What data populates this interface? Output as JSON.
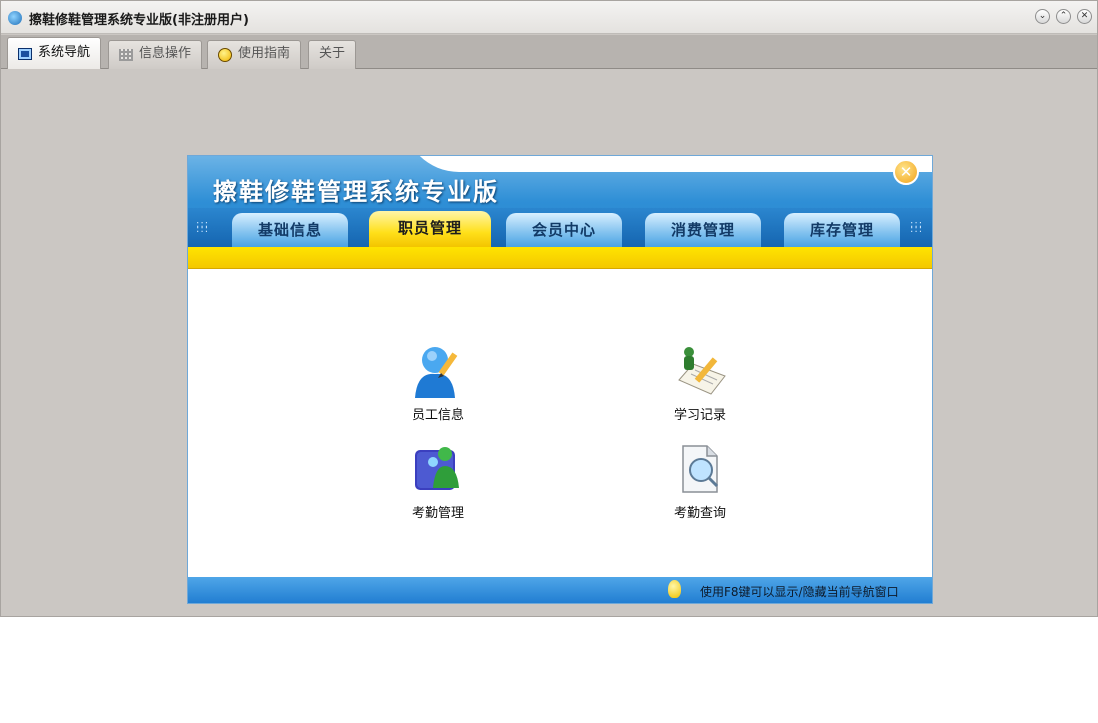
{
  "window": {
    "title": "擦鞋修鞋管理系统专业版(非注册用户)",
    "controls": [
      "⌄",
      "⌃",
      "✕"
    ]
  },
  "tabs": [
    {
      "label": "系统导航",
      "icon": "monitor-icon",
      "active": true
    },
    {
      "label": "信息操作",
      "icon": "grid-icon",
      "active": false
    },
    {
      "label": "使用指南",
      "icon": "smiley-icon",
      "active": false
    },
    {
      "label": "关于",
      "icon": "",
      "active": false
    }
  ],
  "panel": {
    "title": "擦鞋修鞋管理系统专业版",
    "close_glyph": "✕",
    "nav_tabs": [
      {
        "label": "基础信息",
        "active": false
      },
      {
        "label": "职员管理",
        "active": true
      },
      {
        "label": "会员中心",
        "active": false
      },
      {
        "label": "消费管理",
        "active": false
      },
      {
        "label": "库存管理",
        "active": false
      }
    ],
    "items": [
      {
        "label": "员工信息",
        "icon": "employee-pencil-icon"
      },
      {
        "label": "学习记录",
        "icon": "study-record-icon"
      },
      {
        "label": "考勤管理",
        "icon": "attendance-icon"
      },
      {
        "label": "考勤查询",
        "icon": "attendance-search-icon"
      }
    ],
    "footer_tip": "使用F8键可以显示/隐藏当前导航窗口"
  },
  "colors": {
    "accent_blue": "#1f7cc8",
    "accent_yellow": "#ffe01a",
    "window_bg": "#cbc7c3"
  }
}
